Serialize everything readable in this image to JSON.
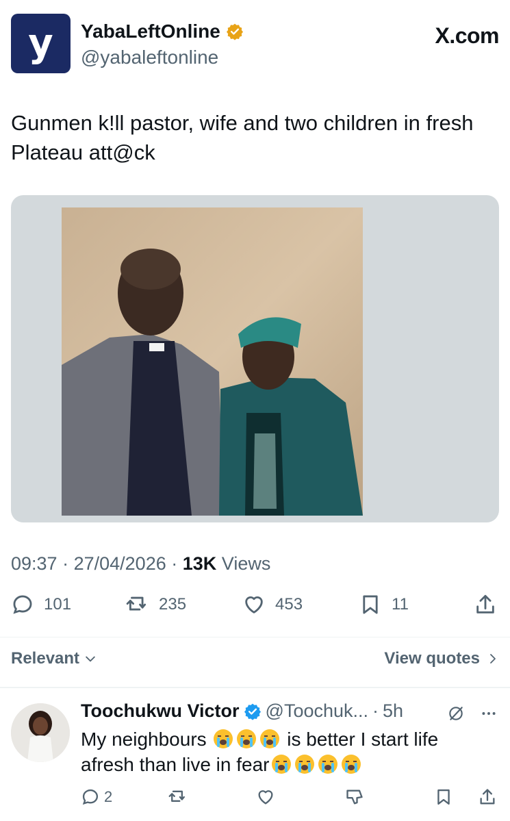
{
  "account": {
    "display_name": "YabaLeftOnline",
    "handle": "@yabaleftonline",
    "avatar_letter": "y",
    "site_label": "X.com"
  },
  "tweet": {
    "text": "Gunmen k!ll pastor, wife and two children in fresh Plateau att@ck",
    "time": "09:37",
    "date": "27/04/2026",
    "views_count": "13K",
    "views_label": "Views",
    "replies": "101",
    "reposts": "235",
    "likes": "453",
    "bookmarks": "11"
  },
  "sort": {
    "label": "Relevant",
    "view_quotes": "View quotes"
  },
  "reply": {
    "name": "Toochukwu Victor",
    "handle": "@Toochuk...",
    "time": "5h",
    "text_part1": "My neighbours",
    "text_part2": "is better I start life afresh than live in fear",
    "replies": "2"
  },
  "colors": {
    "brand_avatar": "#1b2a63",
    "verified_gold": "#e8a317",
    "verified_blue": "#1d9bf0",
    "muted_text": "#536471",
    "media_bg": "#d3d9dc"
  }
}
